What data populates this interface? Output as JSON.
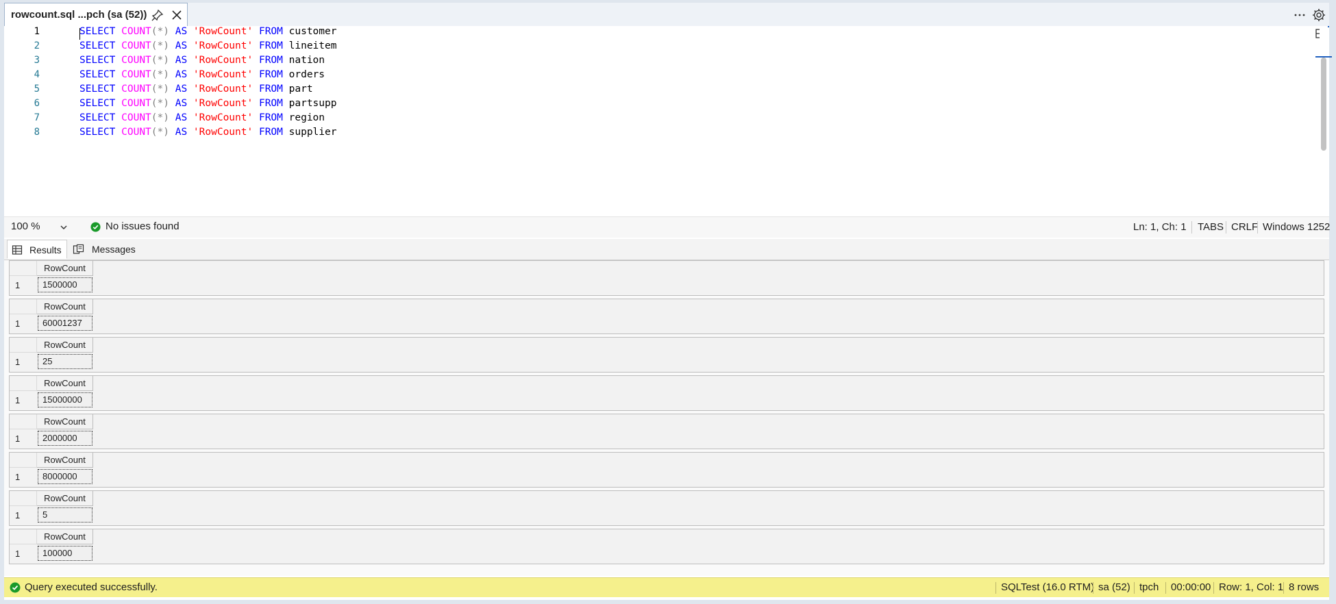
{
  "tab": {
    "title": "rowcount.sql ...pch (sa (52))"
  },
  "editor": {
    "line_numbers": [
      "1",
      "2",
      "3",
      "4",
      "5",
      "6",
      "7",
      "8"
    ],
    "lines": [
      {
        "kw1": "SELECT",
        "fn": "COUNT",
        "args": "(*)",
        "kw2": "AS",
        "str": "'RowCount'",
        "kw3": "FROM",
        "table": "customer"
      },
      {
        "kw1": "SELECT",
        "fn": "COUNT",
        "args": "(*)",
        "kw2": "AS",
        "str": "'RowCount'",
        "kw3": "FROM",
        "table": "lineitem"
      },
      {
        "kw1": "SELECT",
        "fn": "COUNT",
        "args": "(*)",
        "kw2": "AS",
        "str": "'RowCount'",
        "kw3": "FROM",
        "table": "nation"
      },
      {
        "kw1": "SELECT",
        "fn": "COUNT",
        "args": "(*)",
        "kw2": "AS",
        "str": "'RowCount'",
        "kw3": "FROM",
        "table": "orders"
      },
      {
        "kw1": "SELECT",
        "fn": "COUNT",
        "args": "(*)",
        "kw2": "AS",
        "str": "'RowCount'",
        "kw3": "FROM",
        "table": "part"
      },
      {
        "kw1": "SELECT",
        "fn": "COUNT",
        "args": "(*)",
        "kw2": "AS",
        "str": "'RowCount'",
        "kw3": "FROM",
        "table": "partsupp"
      },
      {
        "kw1": "SELECT",
        "fn": "COUNT",
        "args": "(*)",
        "kw2": "AS",
        "str": "'RowCount'",
        "kw3": "FROM",
        "table": "region"
      },
      {
        "kw1": "SELECT",
        "fn": "COUNT",
        "args": "(*)",
        "kw2": "AS",
        "str": "'RowCount'",
        "kw3": "FROM",
        "table": "supplier"
      }
    ]
  },
  "infobar": {
    "zoom": "100 %",
    "issues": "No issues found",
    "position": "Ln: 1, Ch: 1",
    "indent": "TABS",
    "line_ending": "CRLF",
    "encoding": "Windows 1252"
  },
  "result_tabs": {
    "results": "Results",
    "messages": "Messages"
  },
  "grids": [
    {
      "column": "RowCount",
      "row": "1",
      "value": "1500000"
    },
    {
      "column": "RowCount",
      "row": "1",
      "value": "60001237"
    },
    {
      "column": "RowCount",
      "row": "1",
      "value": "25"
    },
    {
      "column": "RowCount",
      "row": "1",
      "value": "15000000"
    },
    {
      "column": "RowCount",
      "row": "1",
      "value": "2000000"
    },
    {
      "column": "RowCount",
      "row": "1",
      "value": "8000000"
    },
    {
      "column": "RowCount",
      "row": "1",
      "value": "5"
    },
    {
      "column": "RowCount",
      "row": "1",
      "value": "100000"
    }
  ],
  "status": {
    "message": "Query executed successfully.",
    "server": "SQLTest (16.0 RTM)",
    "user": "sa (52)",
    "database": "tpch",
    "elapsed": "00:00:00",
    "position": "Row: 1, Col: 1",
    "rows": "8 rows"
  },
  "colors": {
    "keyword": "#0000ff",
    "function": "#ff00ff",
    "string": "#ff0000",
    "line_number": "#237893",
    "status_bar": "#f5f08c",
    "success": "#1a9a2a"
  }
}
